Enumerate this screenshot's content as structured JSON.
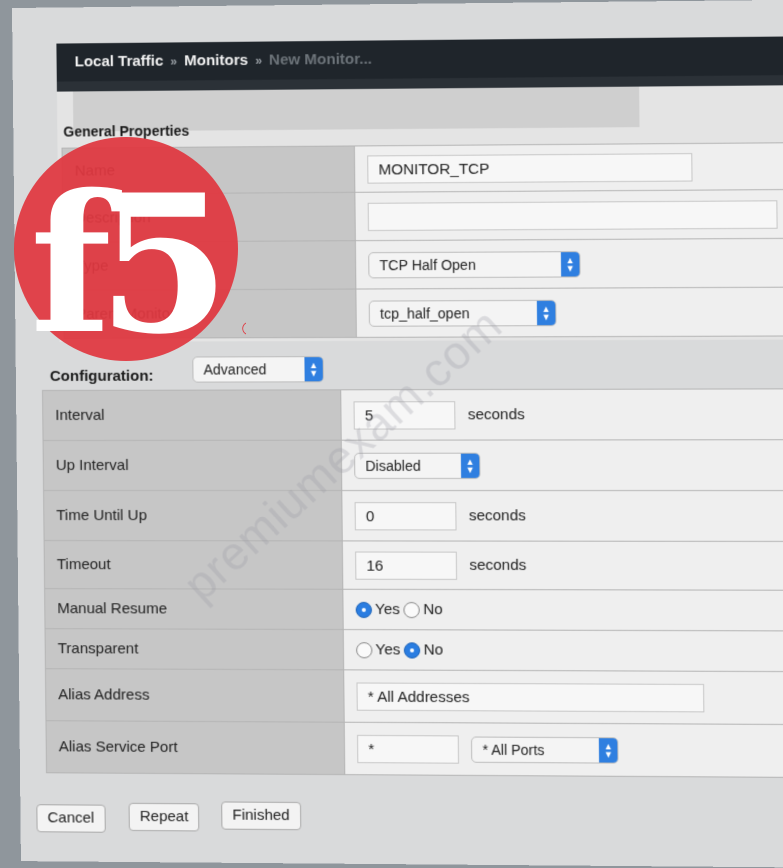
{
  "breadcrumb": {
    "items": [
      "Local Traffic",
      "Monitors",
      "New Monitor..."
    ]
  },
  "general": {
    "title": "General Properties",
    "name_label": "Name",
    "name_value": "MONITOR_TCP",
    "description_label": "Description",
    "description_value": "",
    "type_label": "Type",
    "type_value": "TCP Half Open",
    "parent_label": "Parent Monitor",
    "parent_value": "tcp_half_open"
  },
  "configuration": {
    "title": "Configuration:",
    "mode": "Advanced",
    "interval_label": "Interval",
    "interval_value": "5",
    "interval_unit": "seconds",
    "up_interval_label": "Up Interval",
    "up_interval_value": "Disabled",
    "time_until_up_label": "Time Until Up",
    "time_until_up_value": "0",
    "time_until_up_unit": "seconds",
    "timeout_label": "Timeout",
    "timeout_value": "16",
    "timeout_unit": "seconds",
    "manual_resume_label": "Manual Resume",
    "manual_resume_yes": "Yes",
    "manual_resume_no": "No",
    "manual_resume_selected": "Yes",
    "transparent_label": "Transparent",
    "transparent_yes": "Yes",
    "transparent_no": "No",
    "transparent_selected": "No",
    "alias_address_label": "Alias Address",
    "alias_address_value": "* All Addresses",
    "alias_port_label": "Alias Service Port",
    "alias_port_value": "*",
    "alias_port_select": "* All Ports"
  },
  "buttons": {
    "cancel": "Cancel",
    "repeat": "Repeat",
    "finished": "Finished"
  },
  "logo": {
    "text": "f5",
    "registered": "®",
    "color": "#e0373f"
  },
  "watermark": "premiumexam.com",
  "colors": {
    "accent": "#2a7de1",
    "header_bg": "#1f252b"
  }
}
